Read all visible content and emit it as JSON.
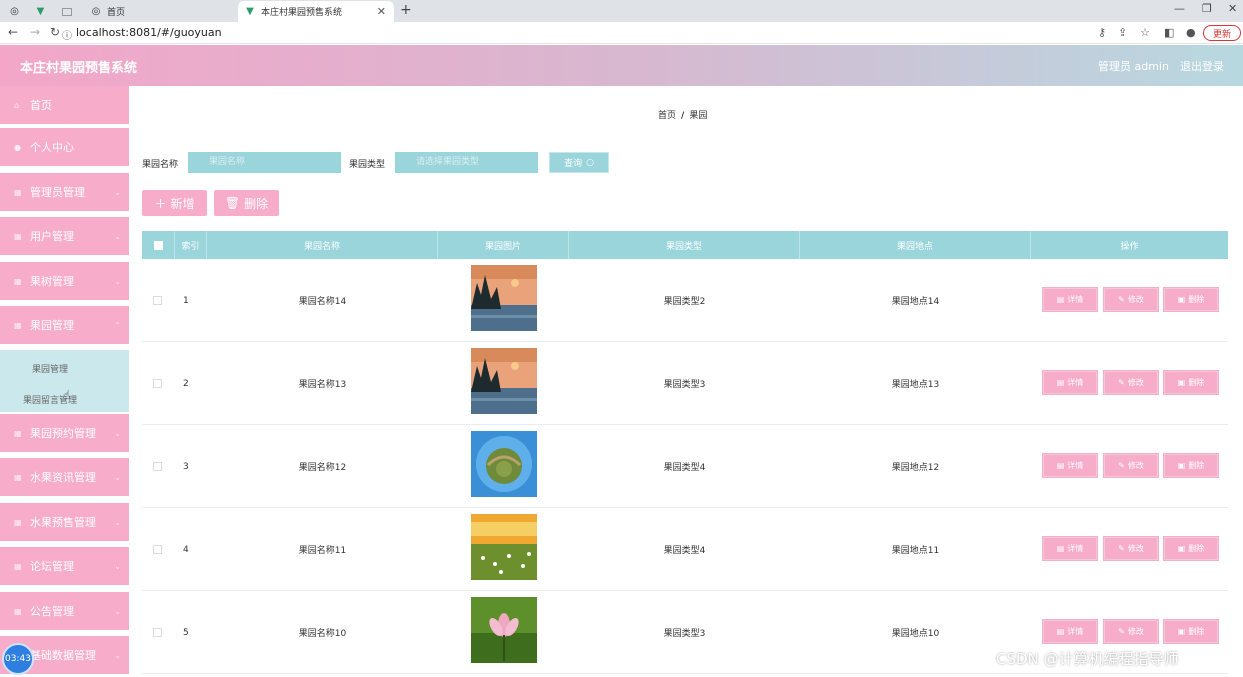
{
  "browser": {
    "tabs": [
      {
        "label": "首页"
      },
      {
        "label": "本庄村果园预售系统"
      }
    ],
    "url": "localhost:8081/#/guoyuan",
    "update_label": "更新"
  },
  "header": {
    "title": "本庄村果园预售系统",
    "admin": "管理员 admin",
    "logout": "退出登录"
  },
  "sidebar": {
    "items": [
      {
        "label": "首页"
      },
      {
        "label": "个人中心"
      },
      {
        "label": "管理员管理"
      },
      {
        "label": "用户管理"
      },
      {
        "label": "果树管理"
      },
      {
        "label": "果园管理"
      },
      {
        "label": "果园预约管理"
      },
      {
        "label": "水果资讯管理"
      },
      {
        "label": "水果预售管理"
      },
      {
        "label": "论坛管理"
      },
      {
        "label": "公告管理"
      },
      {
        "label": "基础数据管理"
      }
    ],
    "submenu": [
      {
        "label": "果园管理"
      },
      {
        "label": "果园留言管理"
      }
    ]
  },
  "breadcrumb": {
    "home": "首页",
    "sep": "/",
    "current": "果园"
  },
  "search": {
    "name_label": "果园名称",
    "name_placeholder": "果园名称",
    "type_label": "果园类型",
    "type_placeholder": "请选择果园类型",
    "query_label": "查询"
  },
  "actions": {
    "add_label": "新增",
    "delete_label": "删除"
  },
  "table": {
    "columns": [
      "索引",
      "果园名称",
      "果园图片",
      "果园类型",
      "果园地点",
      "操作"
    ],
    "ops": {
      "detail": "详情",
      "edit": "修改",
      "delete": "删除"
    },
    "rows": [
      {
        "index": "1",
        "name": "果园名称14",
        "image": "lake-sunset",
        "type": "果园类型2",
        "location": "果园地点14"
      },
      {
        "index": "2",
        "name": "果园名称13",
        "image": "lake-sunset",
        "type": "果园类型3",
        "location": "果园地点13"
      },
      {
        "index": "3",
        "name": "果园名称12",
        "image": "tiny-planet",
        "type": "果园类型4",
        "location": "果园地点12"
      },
      {
        "index": "4",
        "name": "果园名称11",
        "image": "flower-field",
        "type": "果园类型4",
        "location": "果园地点11"
      },
      {
        "index": "5",
        "name": "果园名称10",
        "image": "lotus-flower",
        "type": "果园类型3",
        "location": "果园地点10"
      }
    ]
  },
  "overlay": {
    "clock": "03:43",
    "watermark": "CSDN @计算机编程指导师"
  },
  "colors": {
    "pink": "#f7acc9",
    "teal": "#9ad5dc",
    "submenu": "#cbe9ec"
  }
}
